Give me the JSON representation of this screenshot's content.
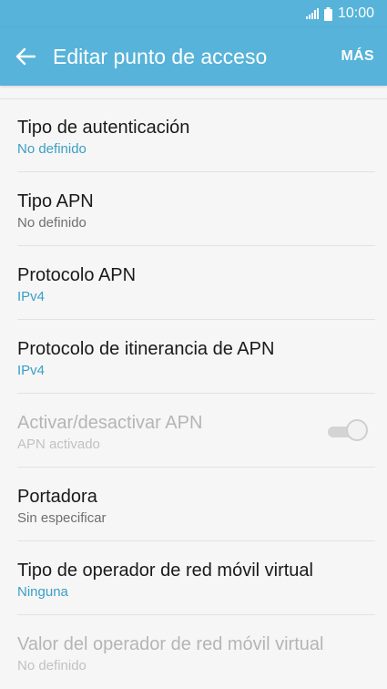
{
  "status_bar": {
    "time": "10:00",
    "signal_icon": "signal-icon",
    "battery_icon": "battery-icon"
  },
  "app_bar": {
    "title": "Editar punto de acceso",
    "back_icon": "back-arrow-icon",
    "more_label": "MÁS"
  },
  "settings": [
    {
      "title": "Tipo de autenticación",
      "value": "No definido",
      "accent": true,
      "enabled": true
    },
    {
      "title": "Tipo APN",
      "value": "No definido",
      "accent": false,
      "enabled": true
    },
    {
      "title": "Protocolo APN",
      "value": "IPv4",
      "accent": true,
      "enabled": true
    },
    {
      "title": "Protocolo de itinerancia de APN",
      "value": "IPv4",
      "accent": true,
      "enabled": true
    },
    {
      "title": "Activar/desactivar APN",
      "value": "APN activado",
      "accent": false,
      "enabled": false,
      "toggle": true
    },
    {
      "title": "Portadora",
      "value": "Sin especificar",
      "accent": false,
      "enabled": true
    },
    {
      "title": "Tipo de operador de red móvil virtual",
      "value": "Ninguna",
      "accent": true,
      "enabled": true
    },
    {
      "title": "Valor del operador de red móvil virtual",
      "value": "No definido",
      "accent": false,
      "enabled": false
    }
  ],
  "colors": {
    "header": "#57b3d9",
    "accent_text": "#3a9fc6"
  }
}
